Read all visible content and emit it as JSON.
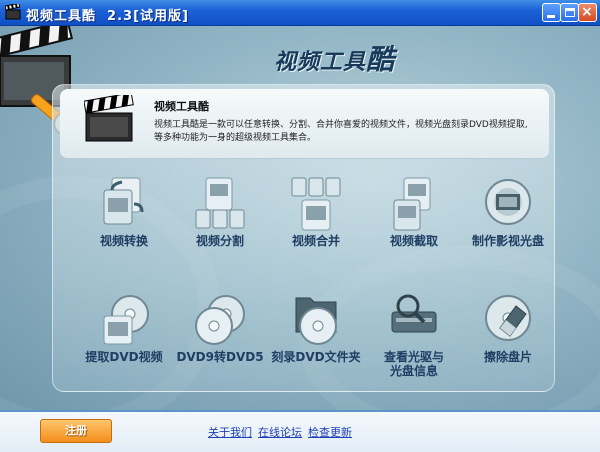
{
  "window": {
    "title": "视频工具酷  2.3[试用版]",
    "close_glyph": "×"
  },
  "header": {
    "logo_text": "视频工具",
    "logo_big_char": "酷"
  },
  "info": {
    "title": "视频工具酷",
    "description": "视频工具酷是一款可以任意转换、分割、合并你喜爱的视频文件，视频光盘刻录DVD视频提取,等多种功能为一身的超级视频工具集合。"
  },
  "features": [
    {
      "label": "视频转换",
      "icon": "video-convert-icon"
    },
    {
      "label": "视频分割",
      "icon": "video-split-icon"
    },
    {
      "label": "视频合并",
      "icon": "video-merge-icon"
    },
    {
      "label": "视频截取",
      "icon": "video-capture-icon"
    },
    {
      "label": "制作影视光盘",
      "icon": "make-video-disc-icon"
    },
    {
      "label": "提取DVD视频",
      "icon": "extract-dvd-icon"
    },
    {
      "label": "DVD9转DVD5",
      "icon": "dvd9-to-dvd5-icon"
    },
    {
      "label": "刻录DVD文件夹",
      "icon": "burn-dvd-folder-icon"
    },
    {
      "label": "查看光驱与\n光盘信息",
      "icon": "drive-info-icon"
    },
    {
      "label": "擦除盘片",
      "icon": "erase-disc-icon"
    }
  ],
  "footer": {
    "register_label": "注册",
    "links": [
      "关于我们",
      "在线论坛",
      "检查更新"
    ]
  },
  "colors": {
    "titlebar": "#1d63d8",
    "background": "#94b7c6",
    "label": "#1f3e63",
    "link": "#1d3fb8",
    "register": "#f28e1c"
  }
}
